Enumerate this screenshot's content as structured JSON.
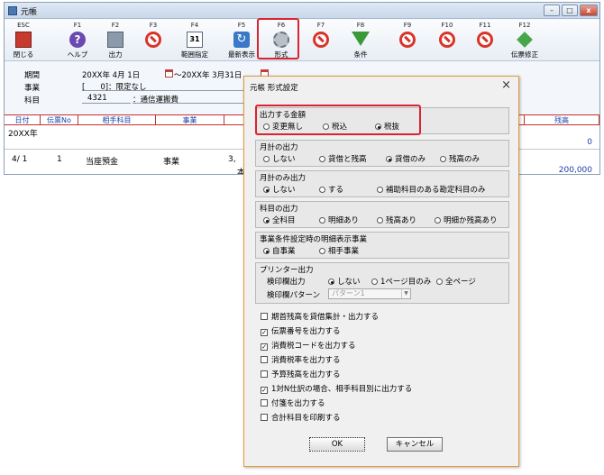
{
  "window": {
    "title": "元帳",
    "minimize": "–",
    "maximize": "□",
    "close": "x"
  },
  "toolbar": {
    "keys": [
      {
        "key": "ESC",
        "label": "閉じる",
        "icon": "exit-icon"
      },
      {
        "key": "F1",
        "label": "ヘルプ",
        "icon": "help-icon"
      },
      {
        "key": "F2",
        "label": "出力",
        "icon": "print-icon"
      },
      {
        "key": "F3",
        "label": "",
        "icon": "no-entry-icon"
      },
      {
        "key": "F4",
        "label": "範囲指定",
        "icon": "calendar-icon",
        "glyph": "31"
      },
      {
        "key": "F5",
        "label": "最新表示",
        "icon": "refresh-icon"
      },
      {
        "key": "F6",
        "label": "形式",
        "icon": "gear-icon"
      },
      {
        "key": "F7",
        "label": "",
        "icon": "no-entry-icon"
      },
      {
        "key": "F8",
        "label": "条件",
        "icon": "filter-icon"
      },
      {
        "key": "F9",
        "label": "",
        "icon": "no-entry-icon"
      },
      {
        "key": "F10",
        "label": "",
        "icon": "no-entry-icon"
      },
      {
        "key": "F11",
        "label": "",
        "icon": "no-entry-icon"
      },
      {
        "key": "F12",
        "label": "伝票修正",
        "icon": "arrow-icon"
      }
    ]
  },
  "info": {
    "period_label": "期間",
    "period_from": "20XX年 4月 1日",
    "period_to": "～20XX年 3月31日",
    "business_label": "事業",
    "business_value": "[　　0]：限定なし",
    "account_label": "科目",
    "account_code": "4321",
    "account_name": "：通信運搬費"
  },
  "ledger": {
    "headers": [
      "日付",
      "伝票No",
      "相手科目",
      "事業",
      "残高"
    ],
    "rows": [
      {
        "date": "20XX年",
        "no": "",
        "counter": "",
        "biz": "",
        "extra": "",
        "balance": "0"
      },
      {
        "date": "4/ 1",
        "no": "1",
        "counter": "当座預金",
        "biz": "事業",
        "extra": "3,",
        "extra2": "本",
        "balance": "200,000"
      }
    ]
  },
  "dialog": {
    "title": "元帳 形式設定",
    "close": "×",
    "amount": {
      "title": "出力する金額",
      "options": [
        "変更無し",
        "税込",
        "税抜"
      ],
      "selected": 2
    },
    "monthly": {
      "title": "月計の出力",
      "options": [
        "しない",
        "貸借と残高",
        "貸借のみ",
        "残高のみ"
      ],
      "selected": 2
    },
    "monthly_only": {
      "title": "月計のみ出力",
      "options": [
        "しない",
        "する",
        "補助科目のある勘定科目のみ"
      ],
      "selected": 0
    },
    "account_output": {
      "title": "科目の出力",
      "options": [
        "全科目",
        "明細あり",
        "残高あり",
        "明細か残高あり"
      ],
      "selected": 0
    },
    "business_detail": {
      "title": "事業条件設定時の明細表示事業",
      "options": [
        "自事業",
        "相手事業"
      ],
      "selected": 0
    },
    "printer": {
      "title": "プリンター出力",
      "stamp_label": "検印欄出力",
      "stamp_options": [
        "しない",
        "1ページ目のみ",
        "全ページ"
      ],
      "stamp_selected": 0,
      "pattern_label": "検印欄パターン",
      "pattern_value": "パターン1"
    },
    "checks": [
      {
        "label": "期首残高を貸借集計・出力する",
        "checked": false
      },
      {
        "label": "伝票番号を出力する",
        "checked": true
      },
      {
        "label": "消費税コードを出力する",
        "checked": true
      },
      {
        "label": "消費税率を出力する",
        "checked": false
      },
      {
        "label": "予算残高を出力する",
        "checked": false
      },
      {
        "label": "1対N仕訳の場合、相手科目別に出力する",
        "checked": true
      },
      {
        "label": "付箋を出力する",
        "checked": false
      },
      {
        "label": "合計科目を印刷する",
        "checked": false
      }
    ],
    "ok": "OK",
    "cancel": "キャンセル"
  },
  "colors": {
    "highlight": "#d9232e",
    "dialog_border": "#e39a3a",
    "grid_red": "#c03030",
    "header_blue": "#1a3fa8"
  }
}
